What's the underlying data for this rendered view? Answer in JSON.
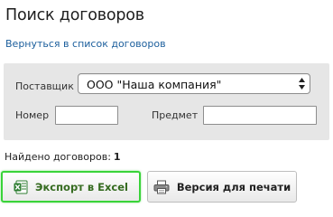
{
  "page": {
    "title": "Поиск договоров",
    "back_link": "Вернуться в список договоров"
  },
  "filters": {
    "supplier_label": "Поставщик",
    "supplier_value": "ООО \"Наша компания\"",
    "number_label": "Номер",
    "number_value": "",
    "subject_label": "Предмет",
    "subject_value": ""
  },
  "results": {
    "found_label": "Найдено договоров:",
    "found_count": "1"
  },
  "buttons": {
    "excel_label": "Экспорт в Excel",
    "excel_icon": "excel-icon",
    "print_label": "Версия для печати",
    "print_icon": "printer-icon"
  },
  "colors": {
    "link": "#1b5e9c",
    "panel_bg": "#e6e6e6",
    "excel_highlight": "#39d339",
    "excel_icon_green": "#2e7d32"
  }
}
